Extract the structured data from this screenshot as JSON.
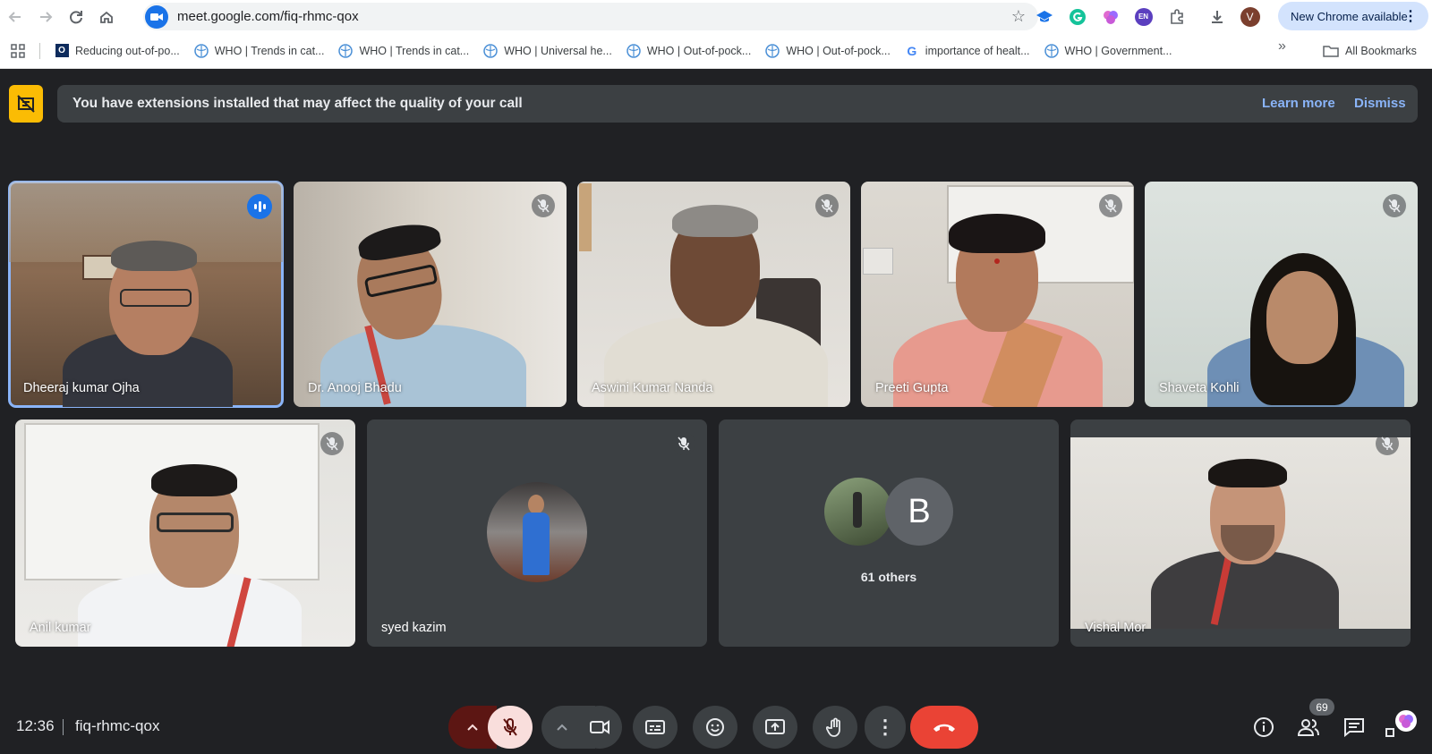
{
  "browser": {
    "url": "meet.google.com/fiq-rhmc-qox",
    "new_chrome_label": "New Chrome available",
    "profile_initial": "V",
    "extension_lang_label": "EN"
  },
  "bookmarks": {
    "items": [
      {
        "label": "Reducing out-of-po...",
        "icon": "o-favicon"
      },
      {
        "label": "WHO | Trends in cat...",
        "icon": "who-favicon"
      },
      {
        "label": "WHO | Trends in cat...",
        "icon": "who-favicon"
      },
      {
        "label": "WHO | Universal he...",
        "icon": "who-favicon"
      },
      {
        "label": "WHO | Out-of-pock...",
        "icon": "who-favicon"
      },
      {
        "label": "WHO | Out-of-pock...",
        "icon": "who-favicon"
      },
      {
        "label": "importance of healt...",
        "icon": "google-favicon"
      },
      {
        "label": "WHO | Government...",
        "icon": "who-favicon"
      }
    ],
    "all_bookmarks_label": "All Bookmarks"
  },
  "banner": {
    "message": "You have extensions installed that may affect the quality of your call",
    "learn_more": "Learn more",
    "dismiss": "Dismiss"
  },
  "participants": {
    "p1": "Dheeraj kumar Ojha",
    "p2": "Dr. Anooj Bhadu",
    "p3": "Aswini Kumar Nanda",
    "p4": "Preeti Gupta",
    "p5": "Shaveta Kohli",
    "p6": "Anil kumar",
    "p7": "syed kazim",
    "p8": "Vishal Mor"
  },
  "others": {
    "label": "61 others",
    "avatar_letter": "B"
  },
  "footer": {
    "time": "12:36",
    "meeting_code": "fiq-rhmc-qox",
    "people_count": "69"
  },
  "colors": {
    "meet_bg": "#202124",
    "tile_bg": "#3c4043",
    "accent_blue": "#8ab4f8",
    "end_call_red": "#ea4335",
    "warning_yellow": "#fbbc04"
  }
}
